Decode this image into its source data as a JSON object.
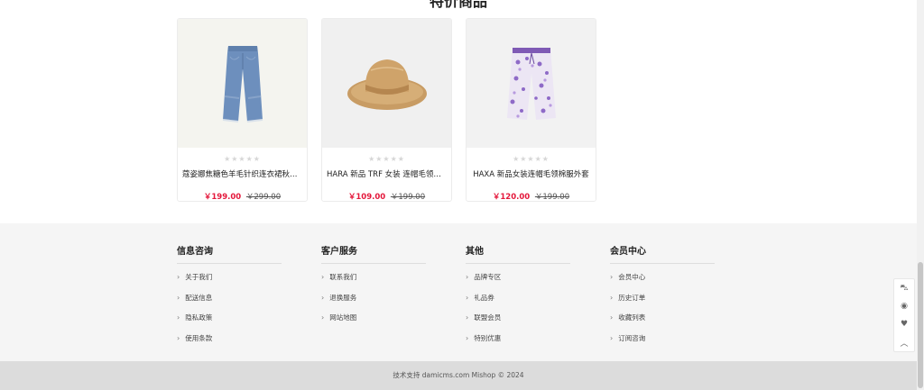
{
  "section": {
    "title": "特价商品"
  },
  "products": [
    {
      "name": "蔻姿娜焦糖色羊毛针织连衣裙秋冬新款",
      "price": "￥199.00",
      "old_price": "￥299.00",
      "rating_stars": "★★★★★",
      "image": "jeans-image"
    },
    {
      "name": "HARA 新品 TRF 女装 连帽毛领棉服外套",
      "price": "￥109.00",
      "old_price": "￥199.00",
      "rating_stars": "★★★★★",
      "image": "straw-hat-image"
    },
    {
      "name": "HAXA 新品女装连帽毛领棉服外套",
      "price": "￥120.00",
      "old_price": "￥199.00",
      "rating_stars": "★★★★★",
      "image": "floral-pants-image"
    }
  ],
  "footer": {
    "columns": [
      {
        "title": "信息咨询",
        "links": [
          "关于我们",
          "配送信息",
          "隐私政策",
          "使用条款"
        ]
      },
      {
        "title": "客户服务",
        "links": [
          "联系我们",
          "退换服务",
          "网站地图"
        ]
      },
      {
        "title": "其他",
        "links": [
          "品牌专区",
          "礼品券",
          "联盟会员",
          "特别优惠"
        ]
      },
      {
        "title": "会员中心",
        "links": [
          "会员中心",
          "历史订单",
          "收藏列表",
          "订阅咨询"
        ]
      }
    ],
    "copyright": "技术支持 damicms.com Mishop © 2024"
  },
  "toolbar": {
    "items": [
      {
        "icon": "cart-icon",
        "glyph": "⛍"
      },
      {
        "icon": "user-icon",
        "glyph": "◉"
      },
      {
        "icon": "heart-icon",
        "glyph": "♥"
      },
      {
        "icon": "back-to-top-icon",
        "glyph": "︿"
      }
    ]
  },
  "colors": {
    "price": "#e4173b",
    "footer_bg": "#f5f5f5",
    "copyright_bg": "#dcdcdc"
  }
}
